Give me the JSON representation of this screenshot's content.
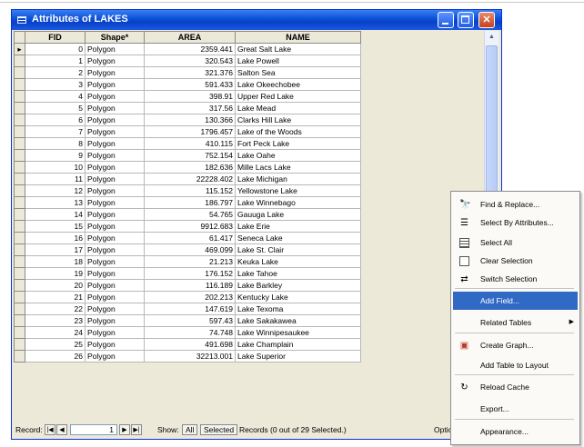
{
  "window": {
    "title": "Attributes of LAKES"
  },
  "columns": [
    "FID",
    "Shape*",
    "AREA",
    "NAME"
  ],
  "rows": [
    [
      "0",
      "Polygon",
      "2359.441",
      "Great Salt Lake"
    ],
    [
      "1",
      "Polygon",
      "320.543",
      "Lake Powell"
    ],
    [
      "2",
      "Polygon",
      "321.376",
      "Salton Sea"
    ],
    [
      "3",
      "Polygon",
      "591.433",
      "Lake Okeechobee"
    ],
    [
      "4",
      "Polygon",
      "398.91",
      "Upper Red Lake"
    ],
    [
      "5",
      "Polygon",
      "317.56",
      "Lake Mead"
    ],
    [
      "6",
      "Polygon",
      "130.366",
      "Clarks Hill Lake"
    ],
    [
      "7",
      "Polygon",
      "1796.457",
      "Lake of the Woods"
    ],
    [
      "8",
      "Polygon",
      "410.115",
      "Fort Peck Lake"
    ],
    [
      "9",
      "Polygon",
      "752.154",
      "Lake Oahe"
    ],
    [
      "10",
      "Polygon",
      "182.636",
      "Mille Lacs Lake"
    ],
    [
      "11",
      "Polygon",
      "22228.402",
      "Lake Michigan"
    ],
    [
      "12",
      "Polygon",
      "115.152",
      "Yellowstone Lake"
    ],
    [
      "13",
      "Polygon",
      "186.797",
      "Lake Winnebago"
    ],
    [
      "14",
      "Polygon",
      "54.765",
      "Gauuga Lake"
    ],
    [
      "15",
      "Polygon",
      "9912.683",
      "Lake Erie"
    ],
    [
      "16",
      "Polygon",
      "61.417",
      "Seneca Lake"
    ],
    [
      "17",
      "Polygon",
      "469.099",
      "Lake St. Clair"
    ],
    [
      "18",
      "Polygon",
      "21.213",
      "Keuka Lake"
    ],
    [
      "19",
      "Polygon",
      "176.152",
      "Lake Tahoe"
    ],
    [
      "20",
      "Polygon",
      "116.189",
      "Lake Barkley"
    ],
    [
      "21",
      "Polygon",
      "202.213",
      "Kentucky Lake"
    ],
    [
      "22",
      "Polygon",
      "147.619",
      "Lake Texoma"
    ],
    [
      "23",
      "Polygon",
      "597.43",
      "Lake Sakakawea"
    ],
    [
      "24",
      "Polygon",
      "74.748",
      "Lake Winnipesaukee"
    ],
    [
      "25",
      "Polygon",
      "491.698",
      "Lake Champlain"
    ],
    [
      "26",
      "Polygon",
      "32213.001",
      "Lake Superior"
    ]
  ],
  "current_row_marker": "▸",
  "status": {
    "record_label": "Record:",
    "first_btn": "|◀",
    "prev_btn": "◀",
    "record_value": "1",
    "next_btn": "▶",
    "last_btn": "▶|",
    "show_label": "Show:",
    "all_btn": "All",
    "selected_btn": "Selected",
    "records_text": "Records (0 out of 29 Selected.)",
    "options_label": "Optio"
  },
  "menu": [
    {
      "label": "Find & Replace...",
      "icon": "binoculars-icon",
      "glyph": "🔭"
    },
    {
      "label": "Select By Attributes...",
      "icon": "select-by-attributes-icon",
      "glyph": "☰"
    },
    {
      "label": "Select All",
      "icon": "select-all-icon",
      "glyph": ""
    },
    {
      "label": "Clear Selection",
      "icon": "clear-selection-icon",
      "glyph": ""
    },
    {
      "label": "Switch Selection",
      "icon": "switch-selection-icon",
      "glyph": "⇄"
    },
    {
      "label": "Add Field...",
      "icon": "",
      "glyph": "",
      "highlight": true
    },
    {
      "label": "Related Tables",
      "icon": "",
      "glyph": "",
      "submenu": "▶"
    },
    {
      "label": "Create Graph...",
      "icon": "graph-icon",
      "glyph": "▣"
    },
    {
      "label": "Add Table to Layout",
      "icon": "",
      "glyph": ""
    },
    {
      "label": "Reload Cache",
      "icon": "reload-icon",
      "glyph": "↻"
    },
    {
      "label": "Export...",
      "icon": "",
      "glyph": ""
    },
    {
      "label": "Appearance...",
      "icon": "",
      "glyph": ""
    }
  ],
  "colors": {
    "titlebar": "#0a4fd6",
    "highlight": "#316ac5",
    "graph_icon": "#c0392b"
  }
}
